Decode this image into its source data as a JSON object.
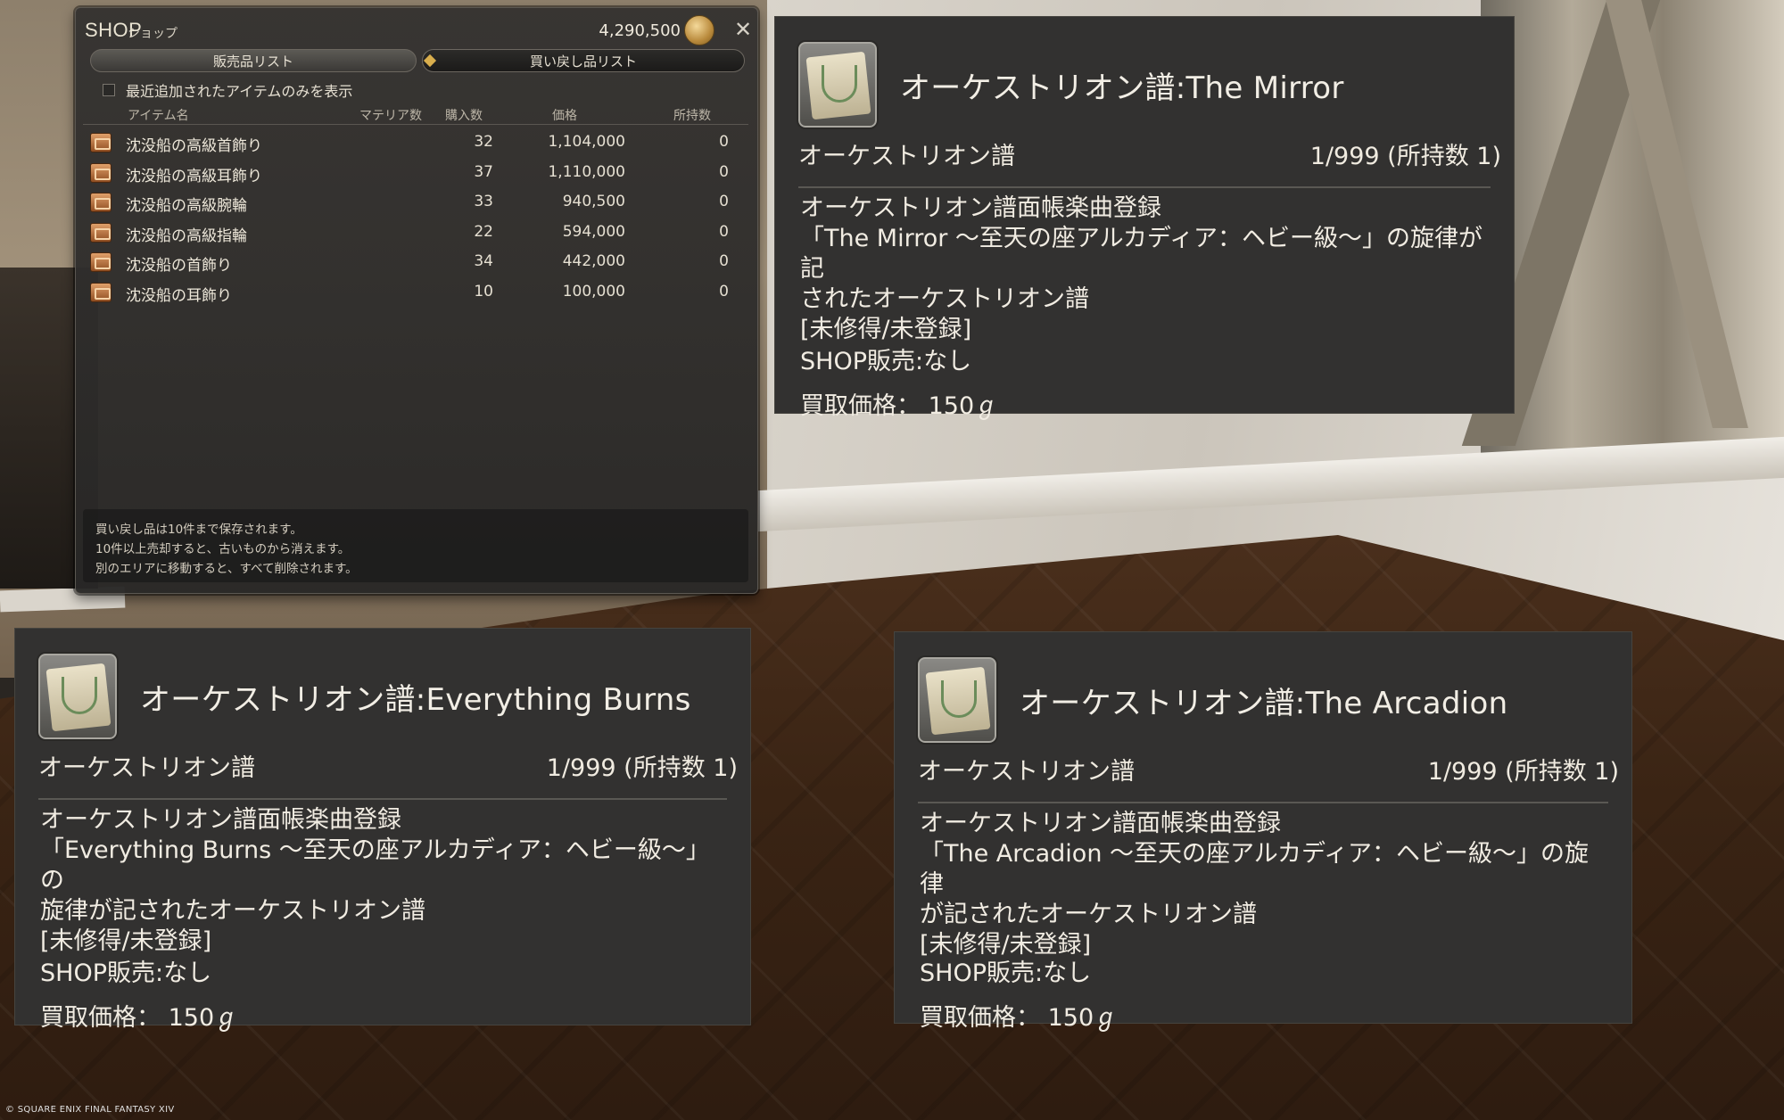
{
  "shop": {
    "title": "SHOP",
    "subtitle": "ショップ",
    "gil": "4,290,500",
    "tabs": {
      "sell": "販売品リスト",
      "buyback": "買い戻し品リスト"
    },
    "filter_label": "最近追加されたアイテムのみを表示",
    "columns": {
      "name": "アイテム名",
      "materia": "マテリア数",
      "qty": "購入数",
      "price": "価格",
      "owned": "所持数"
    },
    "items": [
      {
        "name": "沈没船の高級首飾り",
        "qty": "32",
        "price": "1,104,000",
        "owned": "0"
      },
      {
        "name": "沈没船の高級耳飾り",
        "qty": "37",
        "price": "1,110,000",
        "owned": "0"
      },
      {
        "name": "沈没船の高級腕輪",
        "qty": "33",
        "price": "940,500",
        "owned": "0"
      },
      {
        "name": "沈没船の高級指輪",
        "qty": "22",
        "price": "594,000",
        "owned": "0"
      },
      {
        "name": "沈没船の首飾り",
        "qty": "34",
        "price": "442,000",
        "owned": "0"
      },
      {
        "name": "沈没船の耳飾り",
        "qty": "10",
        "price": "100,000",
        "owned": "0"
      }
    ],
    "notes": [
      "買い戻し品は10件まで保存されます。",
      "10件以上売却すると、古いものから消えます。",
      "別のエリアに移動すると、すべて削除されます。"
    ]
  },
  "tooltips": [
    {
      "title": "オーケストリオン譜:The Mirror",
      "category": "オーケストリオン譜",
      "stock": "1/999 (所持数 1)",
      "body": [
        "オーケストリオン譜面帳楽曲登録",
        "「The Mirror ～至天の座アルカディア：ヘビー級～」の旋律が記",
        "されたオーケストリオン譜",
        "[未修得/未登録]"
      ],
      "shop": "SHOP販売:なし",
      "sell": "買取価格： 150ℊ"
    },
    {
      "title": "オーケストリオン譜:Everything Burns",
      "category": "オーケストリオン譜",
      "stock": "1/999 (所持数 1)",
      "body": [
        "オーケストリオン譜面帳楽曲登録",
        "「Everything Burns ～至天の座アルカディア：ヘビー級～」の",
        "旋律が記されたオーケストリオン譜",
        "[未修得/未登録]"
      ],
      "shop": "SHOP販売:なし",
      "sell": "買取価格： 150ℊ"
    },
    {
      "title": "オーケストリオン譜:The Arcadion",
      "category": "オーケストリオン譜",
      "stock": "1/999 (所持数 1)",
      "body": [
        "オーケストリオン譜面帳楽曲登録",
        "「The Arcadion ～至天の座アルカディア：ヘビー級～」の旋律",
        "が記されたオーケストリオン譜",
        "[未修得/未登録]"
      ],
      "shop": "SHOP販売:なし",
      "sell": "買取価格： 150ℊ"
    }
  ],
  "copyright": "© SQUARE ENIX  FINAL FANTASY XIV"
}
